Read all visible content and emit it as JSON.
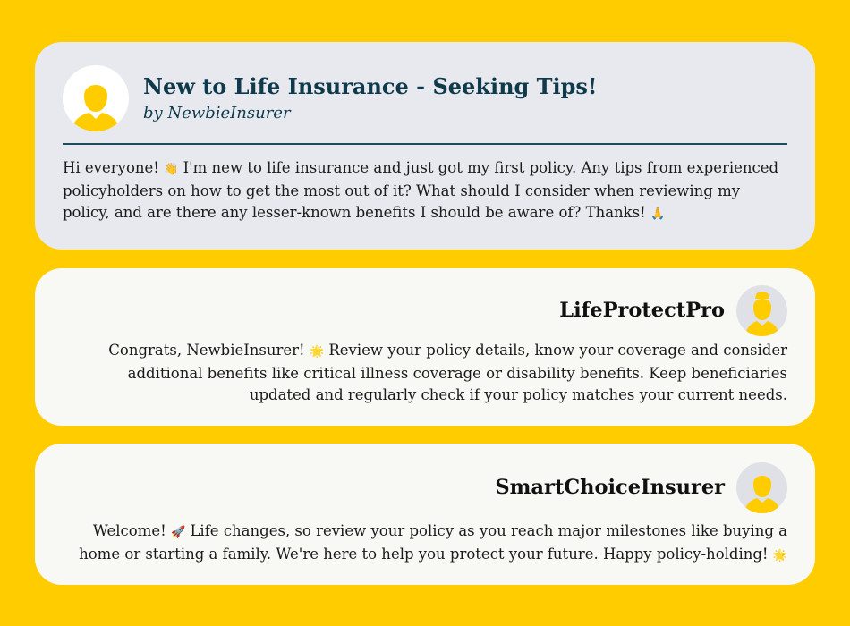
{
  "colors": {
    "page_background": "#ffcc00",
    "title": "#0e3a4c",
    "avatar_silhouette": "#ffcc00"
  },
  "post": {
    "avatar_icon": "person-silhouette-icon",
    "title": "New to Life Insurance - Seeking Tips!",
    "author": "by NewbieInsurer",
    "body": {
      "part1": "Hi everyone! ",
      "emoji1": "👋",
      "part2": " I'm new to life insurance and just got my first policy. Any tips from experienced policyholders on how to get the most out of it? What should I consider when reviewing my policy, and are there any lesser-known benefits I should be aware of? Thanks! ",
      "emoji2": "🙏"
    }
  },
  "replies": [
    {
      "username": "LifeProtectPro",
      "avatar_icon": "person-silhouette-icon",
      "body": {
        "part1": "Congrats, NewbieInsurer! ",
        "emoji1": "🌟",
        "part2": " Review your policy details, know your coverage and consider additional benefits like critical illness coverage or disability benefits. Keep beneficiaries updated and regularly check if your policy matches your current needs."
      }
    },
    {
      "username": "SmartChoiceInsurer",
      "avatar_icon": "person-silhouette-icon",
      "body": {
        "part1": "Welcome! ",
        "emoji1": "🚀",
        "part2": " Life changes, so review your policy as you reach major milestones like buying a home or starting a family. We're here to help you protect your future. Happy policy-holding! ",
        "emoji2": "🌟"
      }
    }
  ]
}
